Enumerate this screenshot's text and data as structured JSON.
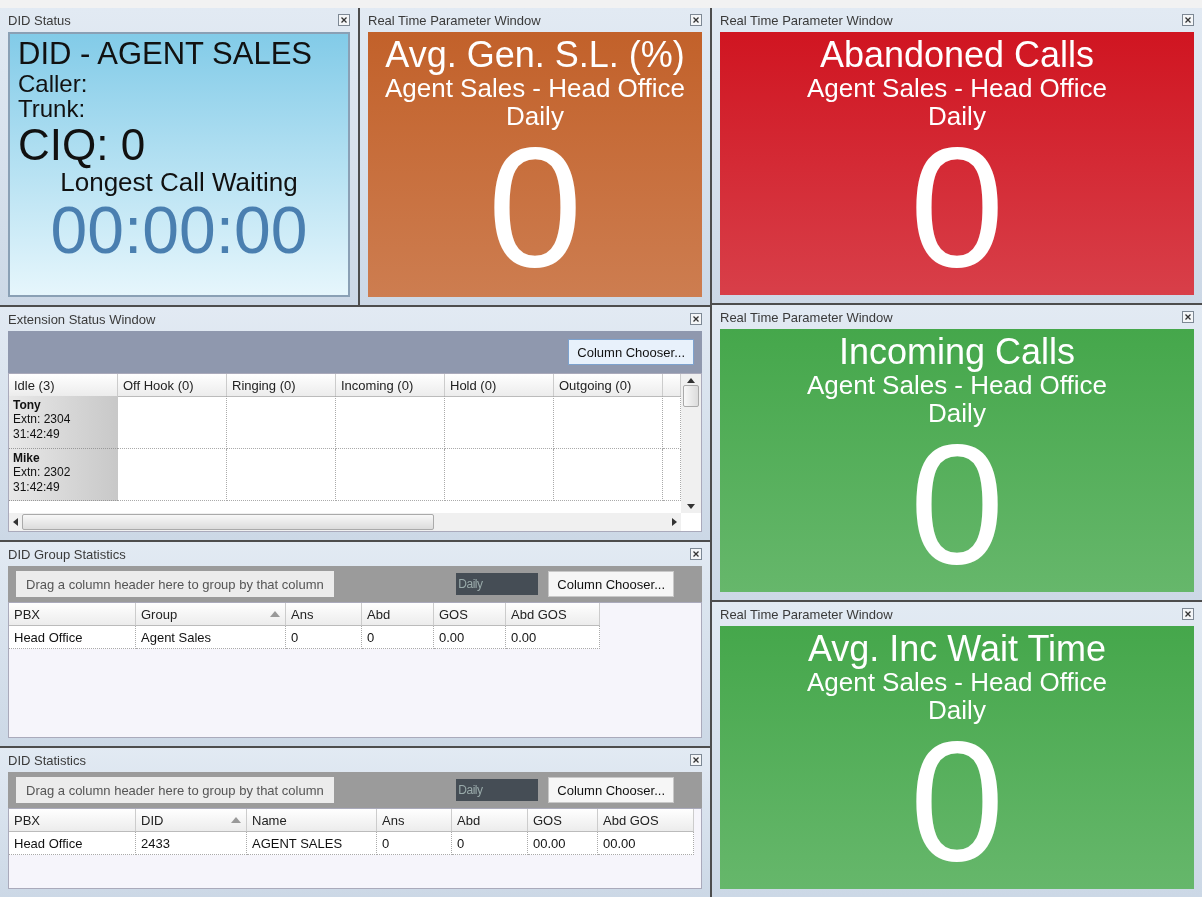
{
  "did_status": {
    "title": "DID Status",
    "heading": "DID - AGENT SALES",
    "caller_label": "Caller:",
    "trunk_label": "Trunk:",
    "ciq": "CIQ: 0",
    "longest_label": "Longest Call Waiting",
    "longest_time": "00:00:00"
  },
  "parameter_windows": [
    {
      "title": "Real Time Parameter Window",
      "metric": "Avg. Gen. S.L. (%)",
      "scope": "Agent Sales - Head Office",
      "period": "Daily",
      "value": "0",
      "color": "#c2612a"
    },
    {
      "title": "Real Time Parameter Window",
      "metric": "Abandoned Calls",
      "scope": "Agent Sales - Head Office",
      "period": "Daily",
      "value": "0",
      "color": "#d01521"
    },
    {
      "title": "Real Time Parameter Window",
      "metric": "Incoming Calls",
      "scope": "Agent Sales - Head Office",
      "period": "Daily",
      "value": "0",
      "color": "#45a74b"
    },
    {
      "title": "Real Time Parameter Window",
      "metric": "Avg. Inc Wait Time",
      "scope": "Agent Sales - Head Office",
      "period": "Daily",
      "value": "0",
      "color": "#45a74b"
    }
  ],
  "extension_status": {
    "title": "Extension Status Window",
    "column_chooser": "Column Chooser...",
    "columns": [
      "Idle (3)",
      "Off Hook (0)",
      "Ringing (0)",
      "Incoming (0)",
      "Hold (0)",
      "Outgoing (0)"
    ],
    "rows": [
      {
        "name": "Tony",
        "extension": "Extn: 2304",
        "time": "31:42:49"
      },
      {
        "name": "Mike",
        "extension": "Extn: 2302",
        "time": "31:42:49"
      }
    ]
  },
  "grids": [
    {
      "title": "DID Group Statistics",
      "group_hint": "Drag a column header here to group by that column",
      "period": "Daily",
      "column_chooser": "Column Chooser...",
      "columns": [
        {
          "label": "PBX",
          "sorted": false
        },
        {
          "label": "Group",
          "sorted": true
        },
        {
          "label": "Ans",
          "sorted": false
        },
        {
          "label": "Abd",
          "sorted": false
        },
        {
          "label": "GOS",
          "sorted": false
        },
        {
          "label": "Abd GOS",
          "sorted": false
        }
      ],
      "rows": [
        [
          "Head Office",
          "Agent Sales",
          "0",
          "0",
          "0.00",
          "0.00"
        ]
      ]
    },
    {
      "title": "DID Statistics",
      "group_hint": "Drag a column header here to group by that column",
      "period": "Daily",
      "column_chooser": "Column Chooser...",
      "columns": [
        {
          "label": "PBX",
          "sorted": false
        },
        {
          "label": "DID",
          "sorted": true
        },
        {
          "label": "Name",
          "sorted": false
        },
        {
          "label": "Ans",
          "sorted": false
        },
        {
          "label": "Abd",
          "sorted": false
        },
        {
          "label": "GOS",
          "sorted": false
        },
        {
          "label": "Abd GOS",
          "sorted": false
        }
      ],
      "rows": [
        [
          "Head Office",
          "2433",
          "AGENT SALES",
          "0",
          "0",
          "00.00",
          "00.00"
        ]
      ]
    }
  ]
}
